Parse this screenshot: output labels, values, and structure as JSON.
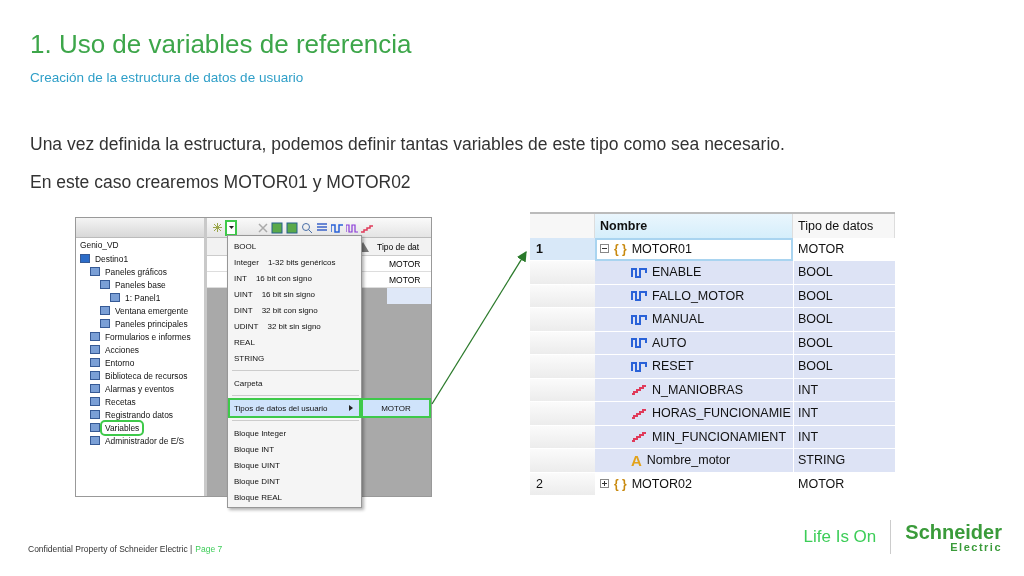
{
  "title": "1. Uso de variables de referencia",
  "subtitle": "Creación de la estructura de datos de usuario",
  "paragraphs": [
    "Una vez definida la estructura, podemos definir tantas variables de este tipo como sea necesario.",
    "En este caso crearemos MOTOR01 y MOTOR02"
  ],
  "project_tree": {
    "root": "Genio_VD",
    "items": [
      {
        "label": "Destino1",
        "highlighted": false,
        "children": [
          {
            "label": "Paneles gráficos",
            "highlighted": false,
            "children": [
              {
                "label": "Paneles base",
                "highlighted": false,
                "children": [
                  {
                    "label": "1: Panel1",
                    "highlighted": false
                  }
                ]
              },
              {
                "label": "Ventana emergente",
                "highlighted": false
              },
              {
                "label": "Paneles principales",
                "highlighted": false
              }
            ]
          },
          {
            "label": "Formularios e informes",
            "highlighted": false
          },
          {
            "label": "Acciones",
            "highlighted": false
          },
          {
            "label": "Entorno",
            "highlighted": false
          },
          {
            "label": "Biblioteca de recursos",
            "highlighted": false
          },
          {
            "label": "Alarmas y eventos",
            "highlighted": false
          },
          {
            "label": "Recetas",
            "highlighted": false
          },
          {
            "label": "Registrando datos",
            "highlighted": false
          },
          {
            "label": "Variables",
            "highlighted": true
          },
          {
            "label": "Administrador de E/S",
            "highlighted": false
          }
        ]
      }
    ]
  },
  "toolbar": {
    "dropdown_highlighted": true
  },
  "back_grid": {
    "column": "Tipo de dat",
    "rows": [
      "MOTOR",
      "MOTOR"
    ]
  },
  "menu": {
    "groups": [
      [
        {
          "label": "BOOL",
          "selected": false
        },
        {
          "label": "Integer",
          "hint": "1-32 bits genéricos",
          "selected": false
        },
        {
          "label": "INT",
          "hint": "16 bit con signo",
          "selected": false
        },
        {
          "label": "UINT",
          "hint": "16 bit sin signo",
          "selected": false
        },
        {
          "label": "DINT",
          "hint": "32 bit con signo",
          "selected": false
        },
        {
          "label": "UDINT",
          "hint": "32 bit sin signo",
          "selected": false
        },
        {
          "label": "REAL",
          "selected": false
        },
        {
          "label": "STRING",
          "selected": false
        }
      ],
      [
        {
          "label": "Carpeta",
          "selected": false
        }
      ],
      [
        {
          "label": "Tipos de datos del usuario",
          "selected": true,
          "submenu": "MOTOR"
        }
      ],
      [
        {
          "label": "Bloque Integer",
          "selected": false
        },
        {
          "label": "Bloque INT",
          "selected": false
        },
        {
          "label": "Bloque UINT",
          "selected": false
        },
        {
          "label": "Bloque DINT",
          "selected": false
        },
        {
          "label": "Bloque REAL",
          "selected": false
        }
      ]
    ]
  },
  "variables_table": {
    "columns": [
      "Nombre",
      "Tipo de datos"
    ],
    "rows": [
      {
        "index": "1",
        "name": "MOTOR01",
        "type": "MOTOR",
        "kind": "struct",
        "icon_text": "{ }",
        "expanded": true,
        "selected": true,
        "children": [
          {
            "name": "ENABLE",
            "type": "BOOL",
            "kind": "bool"
          },
          {
            "name": "FALLO_MOTOR",
            "type": "BOOL",
            "kind": "bool"
          },
          {
            "name": "MANUAL",
            "type": "BOOL",
            "kind": "bool"
          },
          {
            "name": "AUTO",
            "type": "BOOL",
            "kind": "bool"
          },
          {
            "name": "RESET",
            "type": "BOOL",
            "kind": "bool"
          },
          {
            "name": "N_MANIOBRAS",
            "type": "INT",
            "kind": "int"
          },
          {
            "name": "HORAS_FUNCIONAMIE",
            "type": "INT",
            "kind": "int"
          },
          {
            "name": "MIN_FUNCIONAMIENT",
            "type": "INT",
            "kind": "int"
          },
          {
            "name": "Nombre_motor",
            "type": "STRING",
            "kind": "string",
            "icon_text": "A"
          }
        ]
      },
      {
        "index": "2",
        "name": "MOTOR02",
        "type": "MOTOR",
        "kind": "struct",
        "icon_text": "{ }",
        "expanded": false,
        "selected": false
      }
    ]
  },
  "footer": {
    "text": "Confidential Property of Schneider Electric |",
    "page": "Page 7"
  },
  "logo": {
    "tagline": "Life Is On",
    "brand": "Schneider",
    "sub": "Electric"
  }
}
